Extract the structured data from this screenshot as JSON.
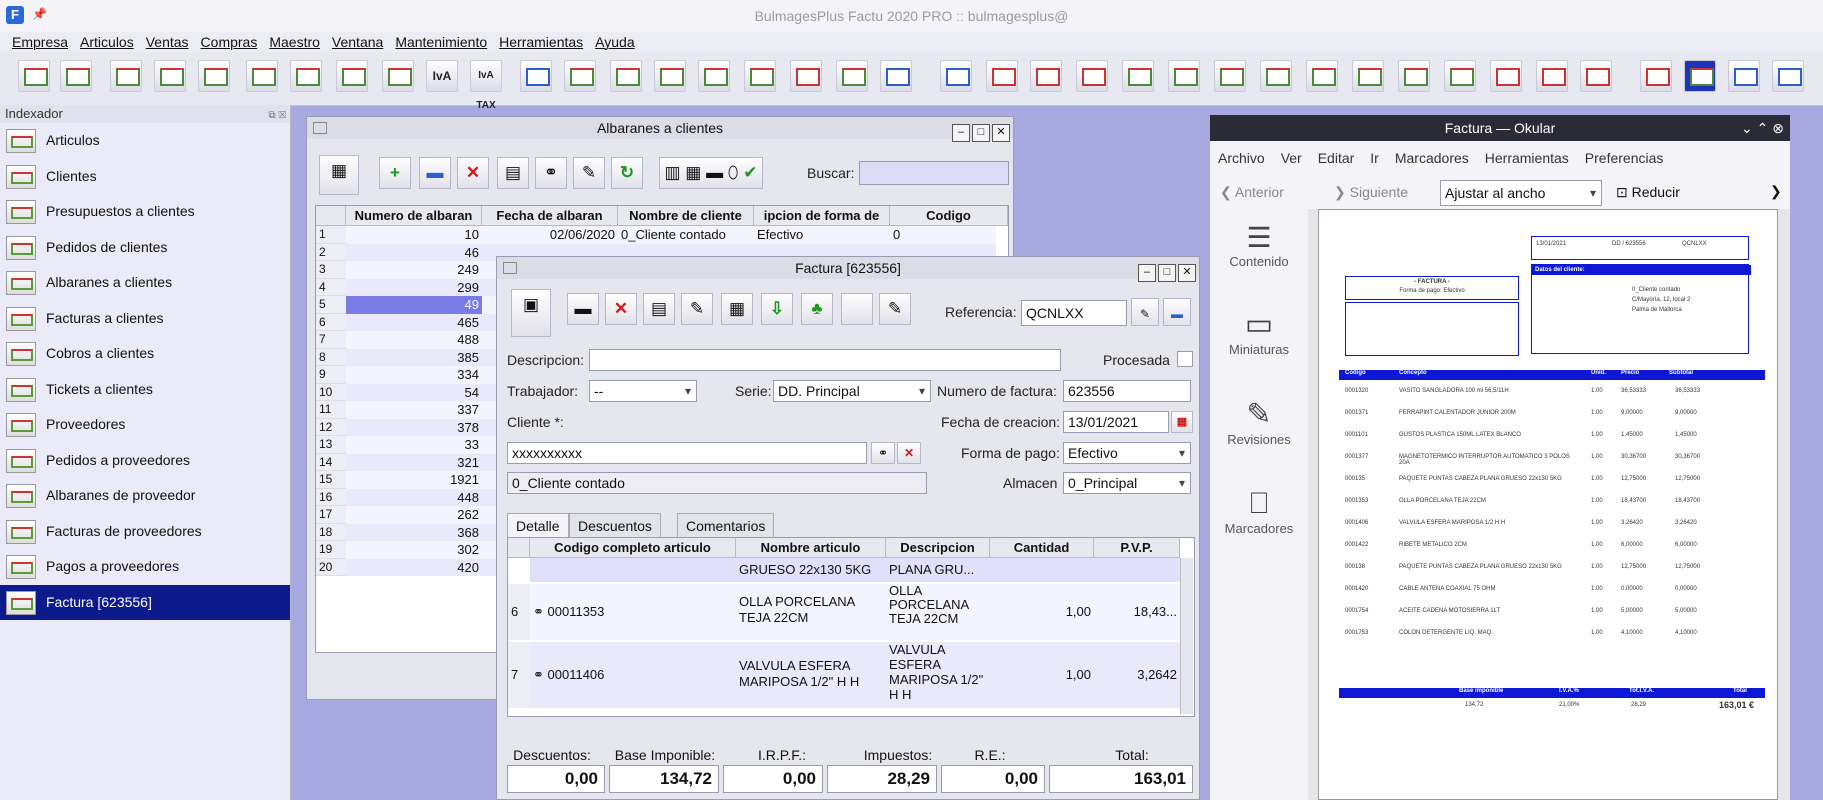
{
  "app": {
    "title": "BulmagesPlus Factu 2020 PRO :: bulmagesplus@",
    "icon_letter": "F"
  },
  "menu": [
    "Empresa",
    "Articulos",
    "Ventas",
    "Compras",
    "Maestro",
    "Ventana",
    "Mantenimiento",
    "Herramientas",
    "Ayuda"
  ],
  "toolbar": {
    "iva_label": "IvA",
    "iva_tax_label": "IvA TAX"
  },
  "sidebar": {
    "title": "Indexador",
    "items": [
      {
        "label": "Articulos"
      },
      {
        "label": "Clientes"
      },
      {
        "label": "Presupuestos a clientes"
      },
      {
        "label": "Pedidos de clientes"
      },
      {
        "label": "Albaranes a clientes"
      },
      {
        "label": "Facturas a clientes"
      },
      {
        "label": "Cobros a clientes"
      },
      {
        "label": "Tickets a clientes"
      },
      {
        "label": "Proveedores"
      },
      {
        "label": "Pedidos a proveedores"
      },
      {
        "label": "Albaranes de proveedor"
      },
      {
        "label": "Facturas de proveedores"
      },
      {
        "label": "Pagos a proveedores"
      },
      {
        "label": "Factura [623556]"
      }
    ]
  },
  "albaranes": {
    "title": "Albaranes a clientes",
    "search_label": "Buscar:",
    "columns": [
      "Numero de albaran",
      "Fecha de albaran",
      "Nombre de cliente",
      "ipcion de forma de",
      "Codigo"
    ],
    "rows": [
      {
        "n": "1",
        "num": "10",
        "fecha": "02/06/2020",
        "cliente": "0_Cliente contado",
        "forma": "Efectivo",
        "codigo": "0"
      },
      {
        "n": "2",
        "num": "46",
        "fecha": "",
        "cliente": "",
        "forma": "",
        "codigo": ""
      },
      {
        "n": "3",
        "num": "249"
      },
      {
        "n": "4",
        "num": "299"
      },
      {
        "n": "5",
        "num": "49"
      },
      {
        "n": "6",
        "num": "465"
      },
      {
        "n": "7",
        "num": "488"
      },
      {
        "n": "8",
        "num": "385"
      },
      {
        "n": "9",
        "num": "334"
      },
      {
        "n": "10",
        "num": "54"
      },
      {
        "n": "11",
        "num": "337"
      },
      {
        "n": "12",
        "num": "378"
      },
      {
        "n": "13",
        "num": "33"
      },
      {
        "n": "14",
        "num": "321"
      },
      {
        "n": "15",
        "num": "1921"
      },
      {
        "n": "16",
        "num": "448"
      },
      {
        "n": "17",
        "num": "262"
      },
      {
        "n": "18",
        "num": "368"
      },
      {
        "n": "19",
        "num": "302"
      },
      {
        "n": "20",
        "num": "420"
      }
    ]
  },
  "factura": {
    "title": "Factura [623556]",
    "referencia_label": "Referencia:",
    "referencia": "QCNLXX",
    "descripcion_label": "Descripcion:",
    "procesada_label": "Procesada",
    "trabajador_label": "Trabajador:",
    "trabajador": "--",
    "serie_label": "Serie:",
    "serie": "DD. Principal",
    "numero_label": "Numero de factura:",
    "numero": "623556",
    "cliente_label": "Cliente *:",
    "fecha_label": "Fecha de creacion:",
    "fecha": "13/01/2021",
    "cliente_code": "xxxxxxxxxx",
    "forma_label": "Forma de pago:",
    "forma": "Efectivo",
    "cliente_name": "0_Cliente contado",
    "almacen_label": "Almacen",
    "almacen": "0_Principal",
    "tabs": [
      "Detalle",
      "Descuentos",
      "Comentarios"
    ],
    "columns": [
      "Codigo completo articulo",
      "Nombre articulo",
      "Descripcion",
      "Cantidad",
      "P.V.P."
    ],
    "partial_row": {
      "nombre": "GRUESO 22x130 5KG",
      "desc": "PLANA GRU..."
    },
    "lines": [
      {
        "n": "6",
        "codigo": "00011353",
        "nombre": "OLLA PORCELANA TEJA 22CM",
        "desc": "OLLA PORCELANA TEJA 22CM",
        "cantidad": "1,00",
        "pvp": "18,43..."
      },
      {
        "n": "7",
        "codigo": "00011406",
        "nombre": "VALVULA ESFERA MARIPOSA 1/2\" H H",
        "desc": "VALVULA ESFERA MARIPOSA 1/2\" H H",
        "cantidad": "1,00",
        "pvp": "3,2642"
      }
    ],
    "totals": {
      "labels": [
        "Descuentos:",
        "Base Imponible:",
        "I.R.P.F.:",
        "Impuestos:",
        "R.E.:",
        "Total:"
      ],
      "values": [
        "0,00",
        "134,72",
        "0,00",
        "28,29",
        "0,00",
        "163,01"
      ]
    }
  },
  "okular": {
    "title": "Factura — Okular",
    "menu": [
      "Archivo",
      "Ver",
      "Editar",
      "Ir",
      "Marcadores",
      "Herramientas",
      "Preferencias"
    ],
    "prev_label": "Anterior",
    "next_label": "Siguiente",
    "zoom": "Ajustar al ancho",
    "reduce_label": "Reducir",
    "side": [
      "Contenido",
      "Miniaturas",
      "Revisiones",
      "Marcadores"
    ],
    "doc": {
      "heading": "- FACTURA -",
      "subheading": "Forma de pago: Efectivo",
      "date": "13/01/2021",
      "invoice": "DD / 623556",
      "ref": "QCNLXX",
      "client_box": "Datos del cliente:",
      "client": "0_Cliente contado",
      "address": "C/Mayoría, 12, local 2",
      "city": "Palma de Mallorca",
      "cols": [
        "Codigo",
        "Concepto",
        "Unid.",
        "Precio",
        "Subtotal"
      ],
      "lines": [
        [
          "0001320",
          "VASITO SANGLADORA 100 ml 56,5/11H",
          "1.00",
          "36,53333",
          "36,53333"
        ],
        [
          "0001371",
          "FERRAPINT CALENTADOR JUNIOR 200M",
          "1.00",
          "9,00000",
          "9,00000"
        ],
        [
          "0001101",
          "GUSTOS PLASTICA 150ML LATEX BLANCO",
          "1.00",
          "1,45000",
          "1,45000"
        ],
        [
          "0001377",
          "MAGNETOTERMICO INTERRUPTOR AUTOMATICO 3 POLOS 20A",
          "1.00",
          "30,36700",
          "30,36700"
        ],
        [
          "000135",
          "PAQUETE PUNTAS CABEZA PLANA GRUESO 22x130 5KG",
          "1.00",
          "12,75000",
          "12,75000"
        ],
        [
          "0001353",
          "OLLA PORCELANA TEJA 22CM",
          "1.00",
          "18,43700",
          "18,43700"
        ],
        [
          "0001406",
          "VALVULA ESFERA MARIPOSA 1/2 H H",
          "1.00",
          "3,26420",
          "3,26420"
        ],
        [
          "0001422",
          "RIBETE METALICO 2CM",
          "1.00",
          "6,00000",
          "6,00000"
        ],
        [
          "000138",
          "PAQUETE PUNTAS CABEZA PLANA GRUESO 22x130 5KG",
          "1.00",
          "12,75000",
          "12,75000"
        ],
        [
          "0001420",
          "CABLE ANTENA COAXIAL 75 OHM",
          "1.00",
          "0,00000",
          "0,00000"
        ],
        [
          "0001754",
          "ACEITE CADENA MOTOSIERRA 1LT",
          "1.00",
          "5,00000",
          "5,00000"
        ],
        [
          "0001753",
          "COLON DETERGENTE LIQ. MAQ.",
          "1.00",
          "4,10000",
          "4,10000"
        ]
      ],
      "foot_cols": [
        "Base imponible",
        "I.V.A.%",
        "Tot.I.V.A.",
        "Total"
      ],
      "foot_vals": [
        "134,72",
        "21,00%",
        "28,29",
        "163,01 €"
      ]
    }
  }
}
